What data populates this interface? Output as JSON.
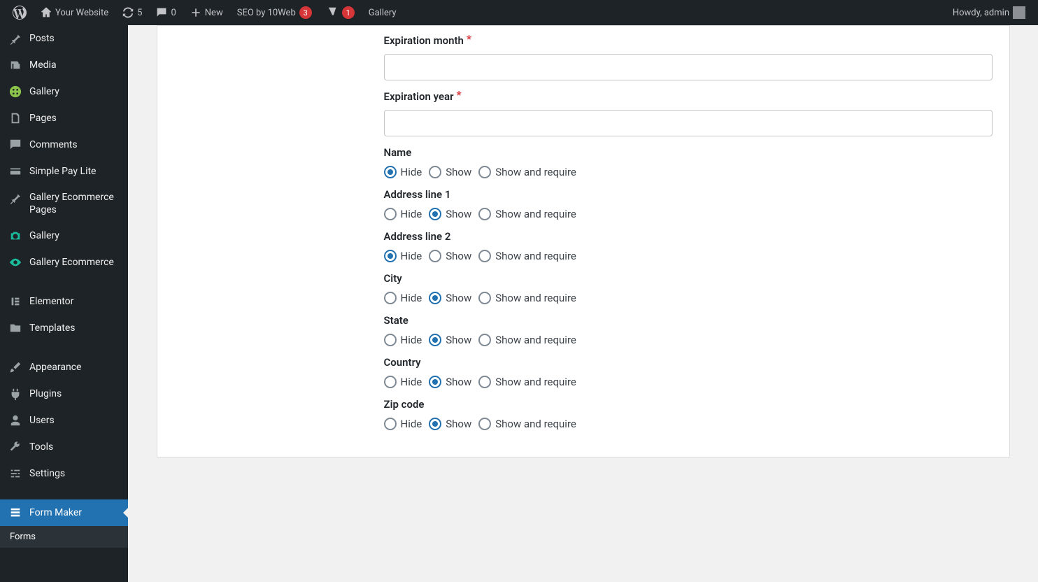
{
  "adminbar": {
    "site_name": "Your Website",
    "updates": "5",
    "comments": "0",
    "new": "New",
    "seo_label": "SEO by 10Web",
    "seo_badge": "3",
    "yoast_badge": "1",
    "gallery": "Gallery",
    "greeting": "Howdy, admin"
  },
  "sidebar": {
    "posts": "Posts",
    "media": "Media",
    "gallery1": "Gallery",
    "pages": "Pages",
    "comments": "Comments",
    "simple_pay": "Simple Pay Lite",
    "gallery_ecom_pages": "Gallery Ecommerce Pages",
    "gallery2": "Gallery",
    "gallery_ecom": "Gallery Ecommerce",
    "elementor": "Elementor",
    "templates": "Templates",
    "appearance": "Appearance",
    "plugins": "Plugins",
    "users": "Users",
    "tools": "Tools",
    "settings": "Settings",
    "form_maker": "Form Maker",
    "forms": "Forms"
  },
  "form": {
    "exp_month": "Expiration month",
    "exp_year": "Expiration year",
    "options": {
      "hide": "Hide",
      "show": "Show",
      "show_require": "Show and require"
    },
    "fields": [
      {
        "label": "Name",
        "selected": "hide"
      },
      {
        "label": "Address line 1",
        "selected": "show"
      },
      {
        "label": "Address line 2",
        "selected": "hide"
      },
      {
        "label": "City",
        "selected": "show"
      },
      {
        "label": "State",
        "selected": "show"
      },
      {
        "label": "Country",
        "selected": "show"
      },
      {
        "label": "Zip code",
        "selected": "show"
      }
    ]
  }
}
